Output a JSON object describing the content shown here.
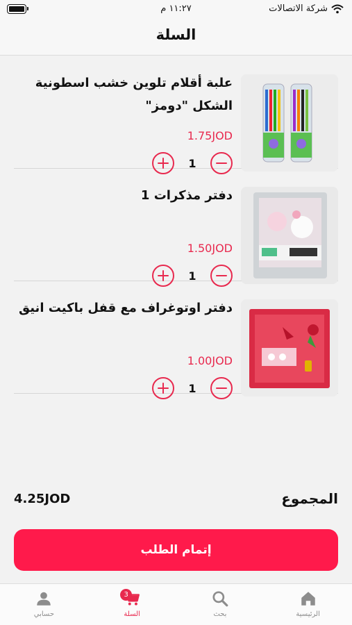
{
  "status": {
    "carrier": "شركة الاتصالات",
    "time": "١١:٢٧ م"
  },
  "header": {
    "title": "السلة"
  },
  "cart": {
    "items": [
      {
        "name": "علبة أقلام تلوين خشب اسطونية الشكل \"دومز\"",
        "price": "1.75JOD",
        "quantity": "1",
        "image_icon": "colored-pencils-image"
      },
      {
        "name": "دفتر مذكرات 1",
        "price": "1.50JOD",
        "quantity": "1",
        "image_icon": "notebook-image"
      },
      {
        "name": "دفتر اوتوغراف مع قفل باكيت انيق",
        "price": "1.00JOD",
        "quantity": "1",
        "image_icon": "autograph-book-image"
      }
    ],
    "total_label": "المجموع",
    "total_value": "4.25JOD",
    "checkout_label": "إتمام الطلب"
  },
  "tabbar": {
    "items": [
      {
        "label": "الرئيسية",
        "icon": "home-icon",
        "active": false
      },
      {
        "label": "بحث",
        "icon": "search-icon",
        "active": false
      },
      {
        "label": "السلة",
        "icon": "cart-icon",
        "active": true,
        "badge": "3"
      },
      {
        "label": "حسابي",
        "icon": "user-icon",
        "active": false
      }
    ]
  },
  "colors": {
    "accent": "#e8294e",
    "button": "#ff1a4b",
    "background": "#f2f2f2"
  }
}
